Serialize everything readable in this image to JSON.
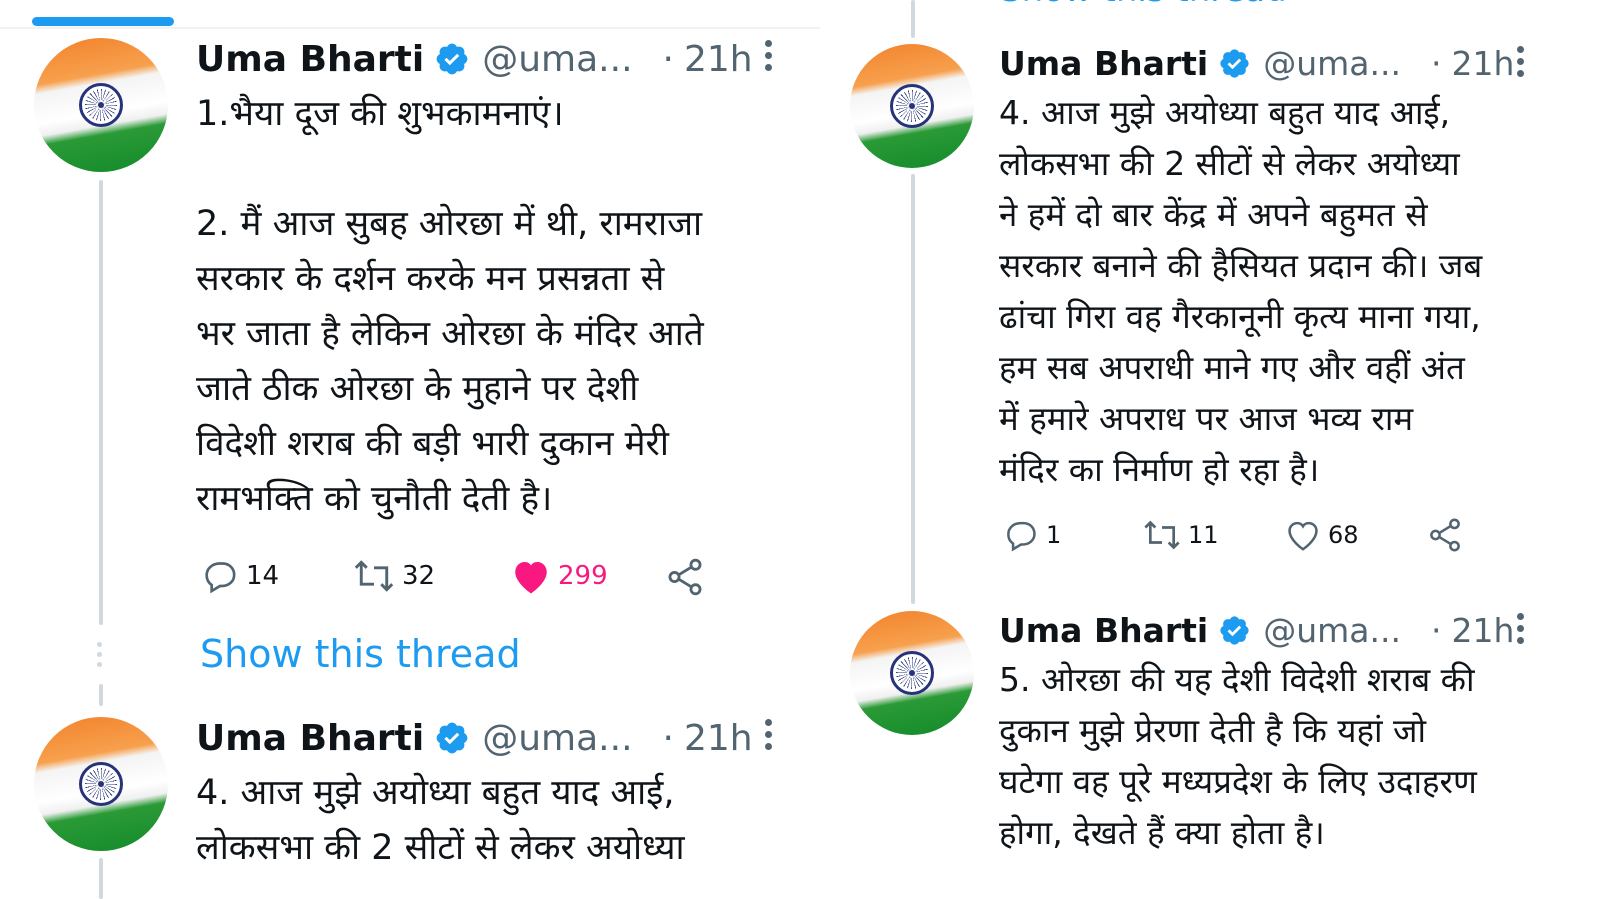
{
  "left_column": {
    "tweet1": {
      "author_name": "Uma Bharti",
      "handle": "@uma...",
      "separator": "·",
      "time": "21h",
      "text": "1.भैया दूज की शुभकामनाएं।\n\n2. मैं आज सुबह ओरछा में थी, रामराजा\nसरकार के दर्शन करके मन प्रसन्नता से\nभर जाता है लेकिन ओरछा के मंदिर आते\nजाते ठीक ओरछा के मुहाने पर देशी\nविदेशी शराब की बड़ी भारी दुकान मेरी\nरामभक्ति को चुनौती देती है।",
      "replies": "14",
      "retweets": "32",
      "likes": "299"
    },
    "show_thread_label": "Show this thread",
    "tweet2": {
      "author_name": "Uma Bharti",
      "handle": "@uma...",
      "separator": "·",
      "time": "21h",
      "text": "4. आज मुझे अयोध्या बहुत याद आई,\nलोकसभा की 2 सीटों से लेकर अयोध्या"
    }
  },
  "right_column": {
    "top_partial_label": "Show this thread",
    "tweet1": {
      "author_name": "Uma Bharti",
      "handle": "@uma...",
      "separator": "·",
      "time": "21h",
      "text": "4. आज मुझे अयोध्या बहुत याद आई,\nलोकसभा की 2 सीटों से लेकर अयोध्या\nने हमें दो बार केंद्र में अपने बहुमत से\nसरकार बनाने की हैसियत प्रदान की। जब\nढांचा गिरा वह गैरकानूनी कृत्य माना गया,\nहम सब अपराधी माने गए और वहीं अंत\nमें हमारे अपराध पर आज भव्य राम\nमंदिर का निर्माण हो रहा है।",
      "replies": "1",
      "retweets": "11",
      "likes": "68"
    },
    "tweet2": {
      "author_name": "Uma Bharti",
      "handle": "@uma...",
      "separator": "·",
      "time": "21h",
      "text": "5. ओरछा की यह देशी विदेशी शराब की\nदुकान मुझे प्रेरणा देती है कि यहां जो\nघटेगा वह पूरे मध्यप्रदेश के लिए उदाहरण\nहोगा, देखते हैं क्या होता है।"
    }
  },
  "icons": {
    "verified": "verified-badge-icon",
    "reply": "reply-icon",
    "retweet": "retweet-icon",
    "like": "heart-icon",
    "share": "share-icon",
    "more": "more-vertical-icon"
  },
  "colors": {
    "accent": "#1d9bf0",
    "like_active": "#f91880",
    "secondary_text": "#536471",
    "thread_line": "#cfd9de"
  }
}
